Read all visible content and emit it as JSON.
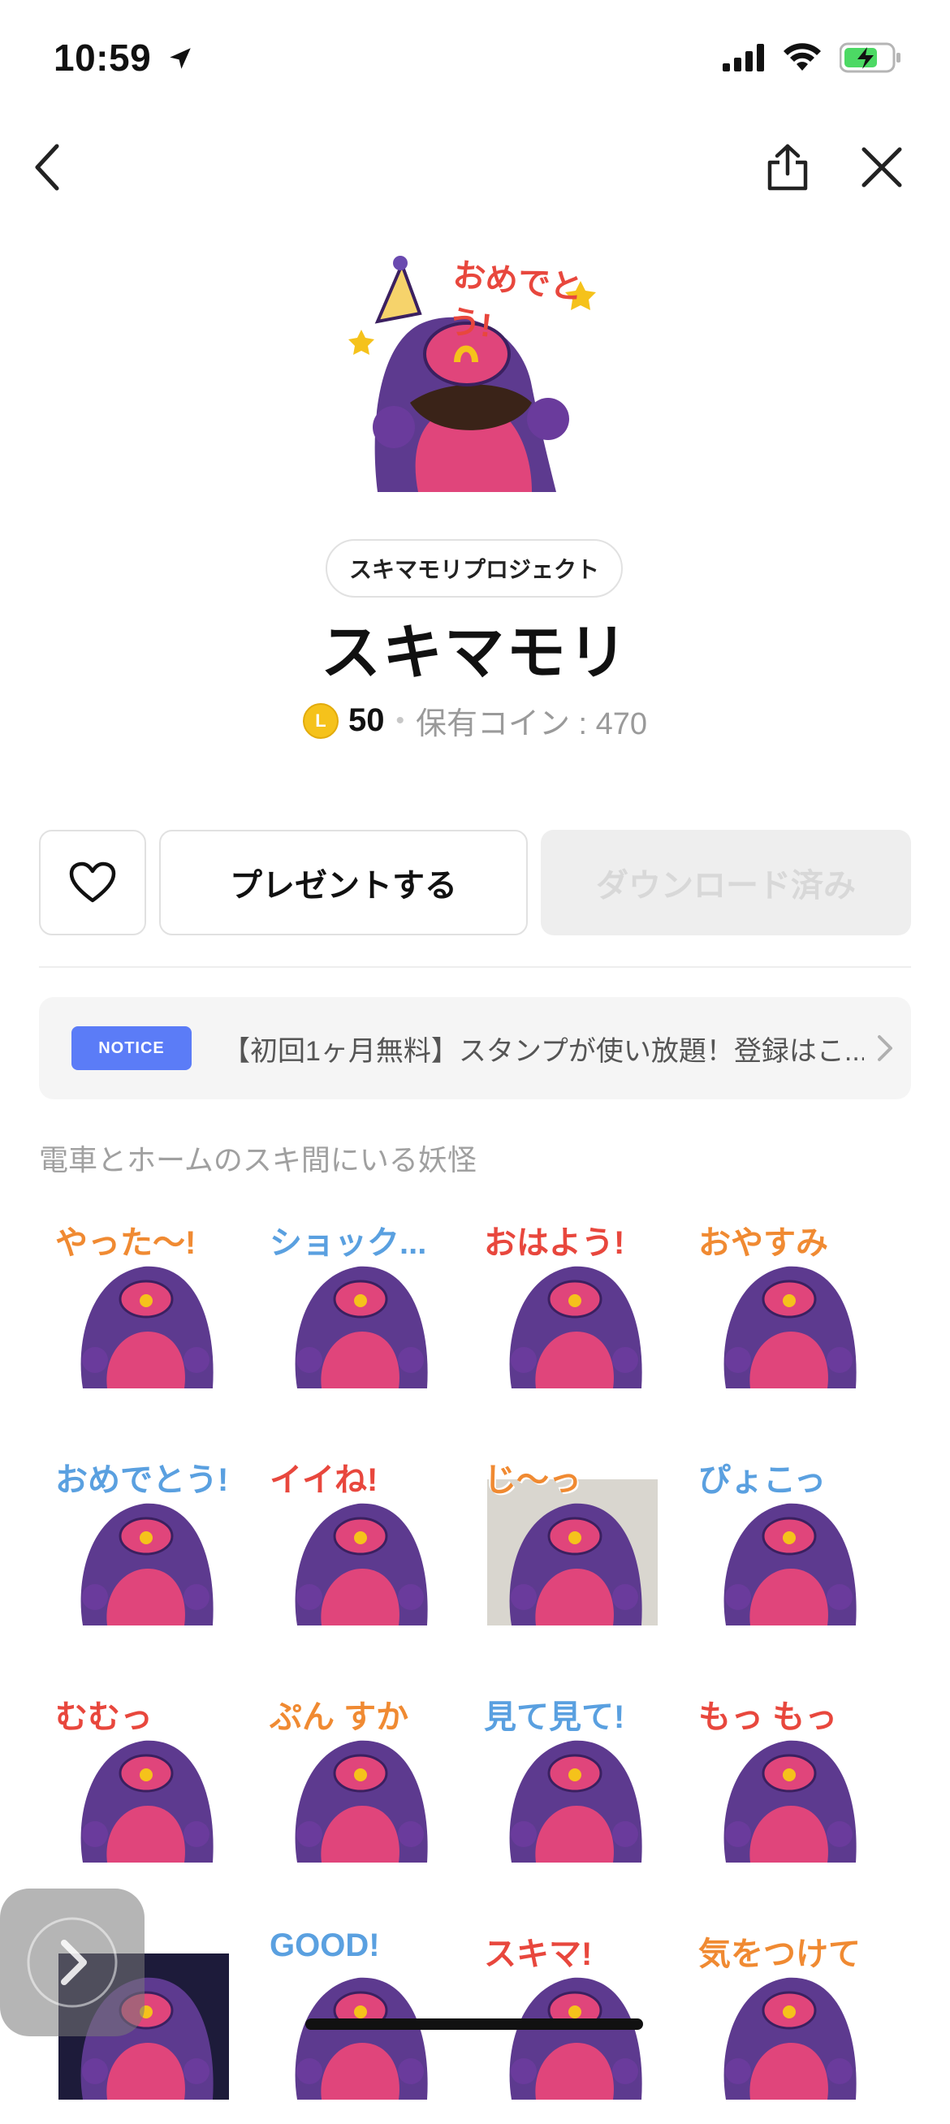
{
  "status_bar": {
    "time": "10:59"
  },
  "product": {
    "author": "スキマモリプロジェクト",
    "title": "スキマモリ",
    "price": "50",
    "coin_symbol": "L",
    "owned_coins": "保有コイン : 470",
    "hero_caption": "おめでとう!"
  },
  "actions": {
    "present_label": "プレゼントする",
    "downloaded_label": "ダウンロード済み"
  },
  "notice": {
    "badge": "NOTICE",
    "text": "【初回1ヶ月無料】スタンプが使い放題！登録はこ..."
  },
  "description": "電車とホームのスキ間にいる妖怪",
  "stickers": [
    {
      "caption": "やった〜!"
    },
    {
      "caption": "ショック..."
    },
    {
      "caption": "おはよう!"
    },
    {
      "caption": "おやすみ"
    },
    {
      "caption": "おめでとう!"
    },
    {
      "caption": "イイね!"
    },
    {
      "caption": "じ〜っ"
    },
    {
      "caption": "ぴょこっ"
    },
    {
      "caption": "むむっ"
    },
    {
      "caption": "ぷん すか"
    },
    {
      "caption": "見て見て!"
    },
    {
      "caption": "もっ もっ"
    },
    {
      "caption": ""
    },
    {
      "caption": "GOOD!"
    },
    {
      "caption": "スキマ!"
    },
    {
      "caption": "気をつけて"
    }
  ],
  "colors": {
    "purple": "#5d3a8f",
    "pink": "#e0457b",
    "notice_blue": "#5b7cf7",
    "coin": "#f5c21b"
  },
  "icons": [
    "back-icon",
    "share-icon",
    "close-icon",
    "heart-icon",
    "chevron-right-icon",
    "location-arrow-icon",
    "signal-icon",
    "wifi-icon",
    "battery-icon"
  ]
}
